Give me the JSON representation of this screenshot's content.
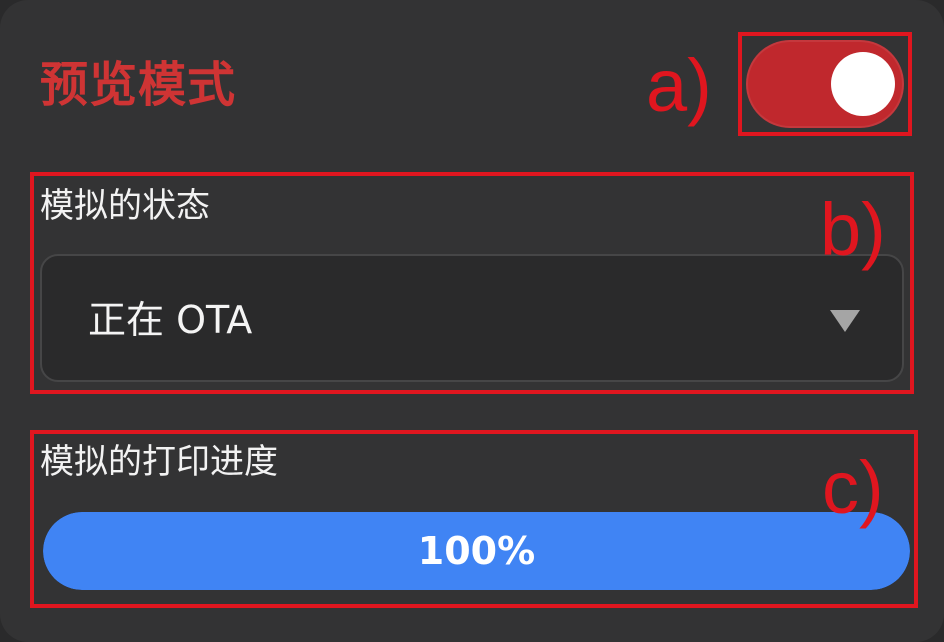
{
  "preview_mode": {
    "title": "预览模式",
    "toggle_on": true
  },
  "simulated_status": {
    "label": "模拟的状态",
    "selected_value": "正在 OTA"
  },
  "simulated_progress": {
    "label": "模拟的打印进度",
    "value": 1.0,
    "display": "100%"
  },
  "annotations": {
    "a": "a)",
    "b": "b)",
    "c": "c)"
  },
  "colors": {
    "accent_red": "#cf3434",
    "annotation_red": "#e0161f",
    "toggle_on": "#c0282d",
    "progress_blue": "#4084f4",
    "panel_bg": "#333334"
  },
  "icons": {
    "select_caret": "caret-down-icon"
  }
}
